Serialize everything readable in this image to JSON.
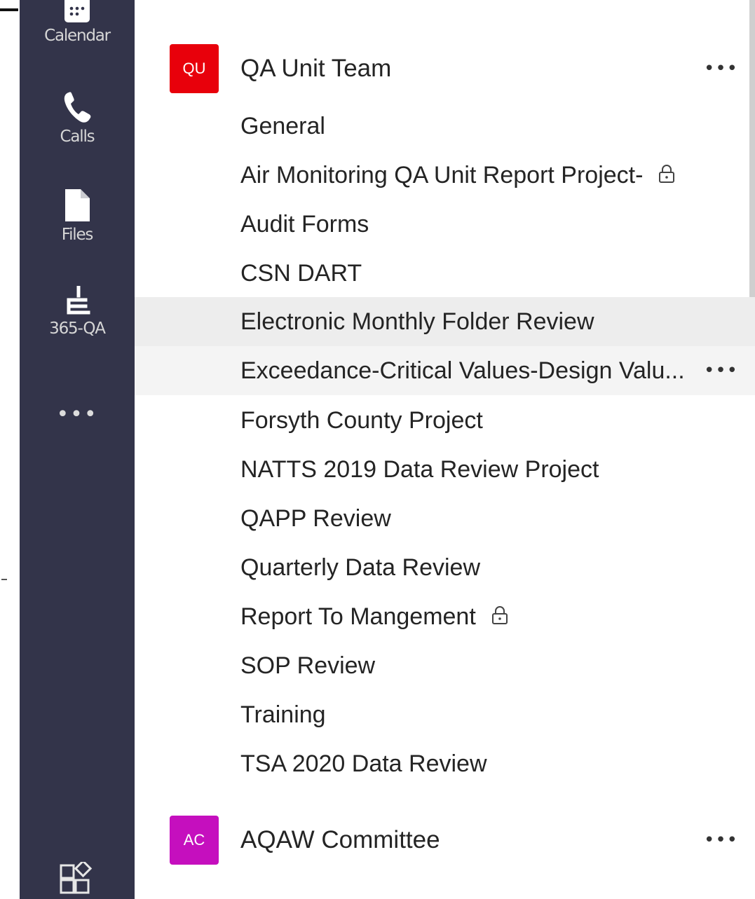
{
  "app_bar": {
    "items": [
      {
        "label": "Calendar",
        "icon": "calendar-icon"
      },
      {
        "label": "Calls",
        "icon": "phone-icon"
      },
      {
        "label": "Files",
        "icon": "file-icon"
      },
      {
        "label": "365-QA",
        "icon": "app-365qa-icon"
      }
    ],
    "more_label": "•••",
    "store_icon": "apps-store-icon",
    "bg_color": "#33344a"
  },
  "teams": [
    {
      "initials": "QU",
      "name": "QA Unit Team",
      "avatar_color": "#e8000b",
      "more_label": "•••",
      "channels": [
        {
          "name": "General",
          "private": false
        },
        {
          "name": "Air Monitoring QA Unit Report Project-",
          "private": true
        },
        {
          "name": "Audit Forms",
          "private": false
        },
        {
          "name": "CSN DART",
          "private": false
        },
        {
          "name": "Electronic Monthly Folder Review",
          "private": false,
          "state": "selected"
        },
        {
          "name": "Exceedance-Critical Values-Design Valu...",
          "private": false,
          "state": "hover",
          "more_label": "•••"
        },
        {
          "name": "Forsyth County Project",
          "private": false
        },
        {
          "name": "NATTS 2019 Data Review Project",
          "private": false
        },
        {
          "name": "QAPP Review",
          "private": false
        },
        {
          "name": "Quarterly Data Review",
          "private": false
        },
        {
          "name": "Report To Mangement",
          "private": true
        },
        {
          "name": "SOP Review",
          "private": false
        },
        {
          "name": "Training",
          "private": false
        },
        {
          "name": "TSA 2020 Data Review",
          "private": false
        }
      ]
    },
    {
      "initials": "AC",
      "name": "AQAW Committee",
      "avatar_color": "#c50fbe",
      "more_label": "•••"
    }
  ]
}
